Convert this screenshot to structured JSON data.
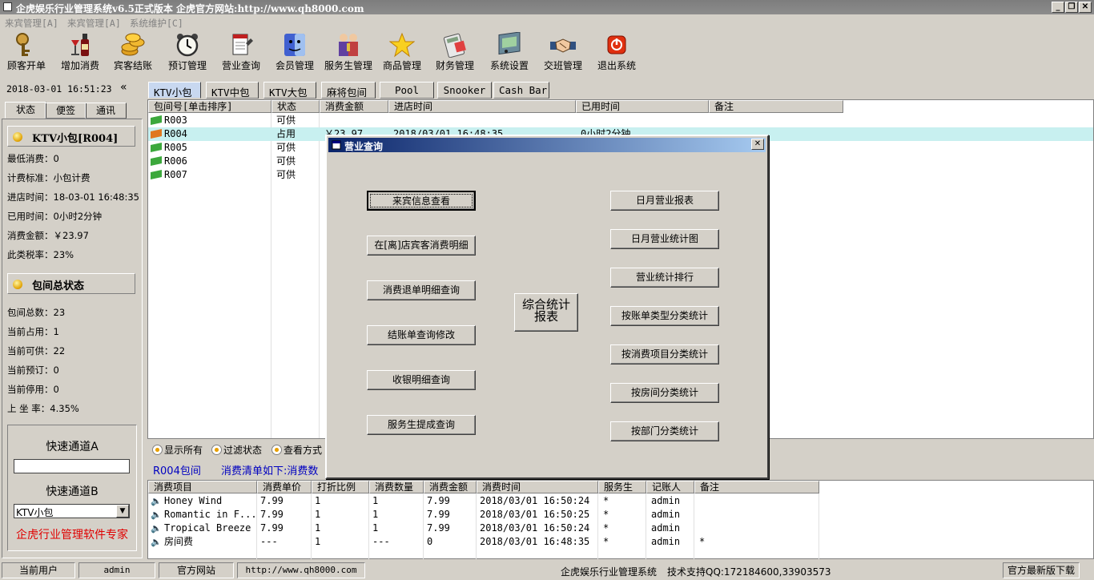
{
  "app": {
    "title": "企虎娱乐行业管理系统v6.5正式版本  企虎官方网站:http://www.qh8000.com",
    "minimize": "_",
    "restore": "❐",
    "close": "✕"
  },
  "menu": [
    "来宾管理[A]",
    "来宾管理[A]",
    "系统维护[C]"
  ],
  "toolbar": [
    {
      "label": "顾客开单",
      "icon": "key-icon"
    },
    {
      "label": "增加消费",
      "icon": "wine-icon"
    },
    {
      "label": "宾客结账",
      "icon": "coins-icon"
    },
    {
      "label": "预订管理",
      "icon": "alarm-clock-icon"
    },
    {
      "label": "营业查询",
      "icon": "notepad-icon"
    },
    {
      "label": "会员管理",
      "icon": "finder-face-icon"
    },
    {
      "label": "服务生管理",
      "icon": "people-icon"
    },
    {
      "label": "商品管理",
      "icon": "star-icon"
    },
    {
      "label": "财务管理",
      "icon": "calculator-icon"
    },
    {
      "label": "系统设置",
      "icon": "settings-panel-icon"
    },
    {
      "label": "交班管理",
      "icon": "handshake-icon"
    },
    {
      "label": "退出系统",
      "icon": "power-icon"
    }
  ],
  "left": {
    "datetime": "2018-03-01 16:51:23",
    "collapse": "«",
    "tabs": [
      "状态",
      "便签",
      "通讯"
    ],
    "room_head": "KTV小包[R004]",
    "room_stats": [
      "最低消费：0",
      "计费标准：小包计费",
      "进店时间：18-03-01 16:48:35",
      "已用时间：0小时2分钟",
      "消费金额：￥23.97",
      "此类税率：23%"
    ],
    "total_head": "包间总状态",
    "total_stats": [
      "包间总数：23",
      "当前占用：1",
      "当前可供：22",
      "当前预订：0",
      "当前停用：0",
      "上 坐 率：4.35%"
    ],
    "quick_a": "快速通道A",
    "quick_a_value": "",
    "quick_b": "快速通道B",
    "quick_b_value": "KTV小包",
    "brand": "企虎行业管理软件专家"
  },
  "room_tabs": [
    "KTV小包",
    "KTV中包",
    "KTV大包",
    "麻将包间",
    "Pool",
    "Snooker",
    "Cash Bar"
  ],
  "room_table": {
    "headers": [
      "包间号[单击排序]",
      "状态",
      "消费金额",
      "进店时间",
      "已用时间",
      "备注"
    ],
    "rows": [
      {
        "room": "R003",
        "status": "可供",
        "amount": "",
        "in_time": "",
        "used": "",
        "note": "",
        "flag": "#3ca83c"
      },
      {
        "room": "R004",
        "status": "占用",
        "amount": "￥23.97",
        "in_time": "2018/03/01 16:48:35",
        "used": "0小时2分钟",
        "note": "",
        "flag": "#e07820"
      },
      {
        "room": "R005",
        "status": "可供",
        "amount": "",
        "in_time": "",
        "used": "",
        "note": "",
        "flag": "#3ca83c"
      },
      {
        "room": "R006",
        "status": "可供",
        "amount": "",
        "in_time": "",
        "used": "",
        "note": "",
        "flag": "#3ca83c"
      },
      {
        "room": "R007",
        "status": "可供",
        "amount": "",
        "in_time": "",
        "used": "",
        "note": "",
        "flag": "#3ca83c"
      }
    ]
  },
  "filters": [
    "显示所有",
    "过滤状态",
    "查看方式"
  ],
  "detail": {
    "room": "R004包间",
    "caption": "消费清单如下:消费数",
    "headers": [
      "消费项目",
      "消费单价",
      "打折比例",
      "消费数量",
      "消费金额",
      "消费时间",
      "服务生",
      "记账人",
      "备注"
    ],
    "rows": [
      [
        "Honey Wind",
        "7.99",
        "1",
        "1",
        "7.99",
        "2018/03/01 16:50:24",
        "*",
        "admin",
        ""
      ],
      [
        "Romantic in F...",
        "7.99",
        "1",
        "1",
        "7.99",
        "2018/03/01 16:50:25",
        "*",
        "admin",
        ""
      ],
      [
        "Tropical Breeze",
        "7.99",
        "1",
        "1",
        "7.99",
        "2018/03/01 16:50:24",
        "*",
        "admin",
        ""
      ],
      [
        "房间费",
        "---",
        "1",
        "---",
        "0",
        "2018/03/01 16:48:35",
        "*",
        "admin",
        "*"
      ]
    ]
  },
  "dialog": {
    "title": "营业查询",
    "close": "✕",
    "left_buttons": [
      "来宾信息查看",
      "在[离]店宾客消费明细",
      "消费退单明细查询",
      "结账单查询修改",
      "收银明细查询",
      "服务生提成查询"
    ],
    "center_line1": "综合统计",
    "center_line2": "报表",
    "right_buttons": [
      "日月营业报表",
      "日月营业统计图",
      "营业统计排行",
      "按账单类型分类统计",
      "按消费项目分类统计",
      "按房间分类统计",
      "按部门分类统计"
    ]
  },
  "status": {
    "user_label": "当前用户",
    "user": "admin",
    "site_label": "官方网站",
    "site": "http://www.qh8000.com",
    "system": "企虎娱乐行业管理系统",
    "support": "技术支持QQ:172184600,33903573",
    "latest": "官方最新版下载"
  },
  "colors": {
    "dialog_caption": "#0a246a",
    "selected_row": "#c8f0f0",
    "brand_red": "#e00000",
    "link_blue": "#0000c0"
  }
}
